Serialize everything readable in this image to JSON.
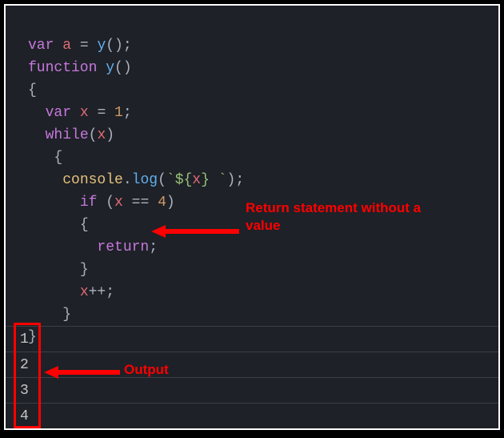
{
  "code": {
    "l1_var": "var",
    "l1_a": "a",
    "l1_eq": " = ",
    "l1_y": "y",
    "l1_tail": "();",
    "l2_fn": "function",
    "l2_sp": " ",
    "l2_name": "y",
    "l2_parens": "()",
    "l3_brace": "{",
    "l4_pad": "  ",
    "l4_var": "var",
    "l4_sp": " ",
    "l4_x": "x",
    "l4_eq": " = ",
    "l4_num": "1",
    "l4_semi": ";",
    "l5_pad": "  ",
    "l5_while": "while",
    "l5_open": "(",
    "l5_x": "x",
    "l5_close": ")",
    "l6_pad": "   ",
    "l6_brace": "{",
    "l7_pad": "    ",
    "l7_console": "console",
    "l7_dot": ".",
    "l7_log": "log",
    "l7_open": "(",
    "l7_t_open": "`",
    "l7_t_doll": "${",
    "l7_t_x": "x",
    "l7_t_closev": "}",
    "l7_t_sp": " ",
    "l7_t_close": "`",
    "l7_close": ");",
    "l8_pad": "      ",
    "l8_if": "if",
    "l8_sp": " (",
    "l8_x": "x",
    "l8_eq": " == ",
    "l8_num": "4",
    "l8_close": ")",
    "l9_pad": "      ",
    "l9_brace": "{",
    "l10_pad": "        ",
    "l10_return": "return",
    "l10_semi": ";",
    "l11_pad": "      ",
    "l11_brace": "}",
    "l12_pad": "      ",
    "l12_x": "x",
    "l12_inc": "++;",
    "l13_pad": "    ",
    "l13_brace": "}",
    "l14_brace": "}"
  },
  "output": [
    "1",
    "2",
    "3",
    "4"
  ],
  "annotations": {
    "return_note": "Return statement without a value",
    "output_note": "Output"
  }
}
